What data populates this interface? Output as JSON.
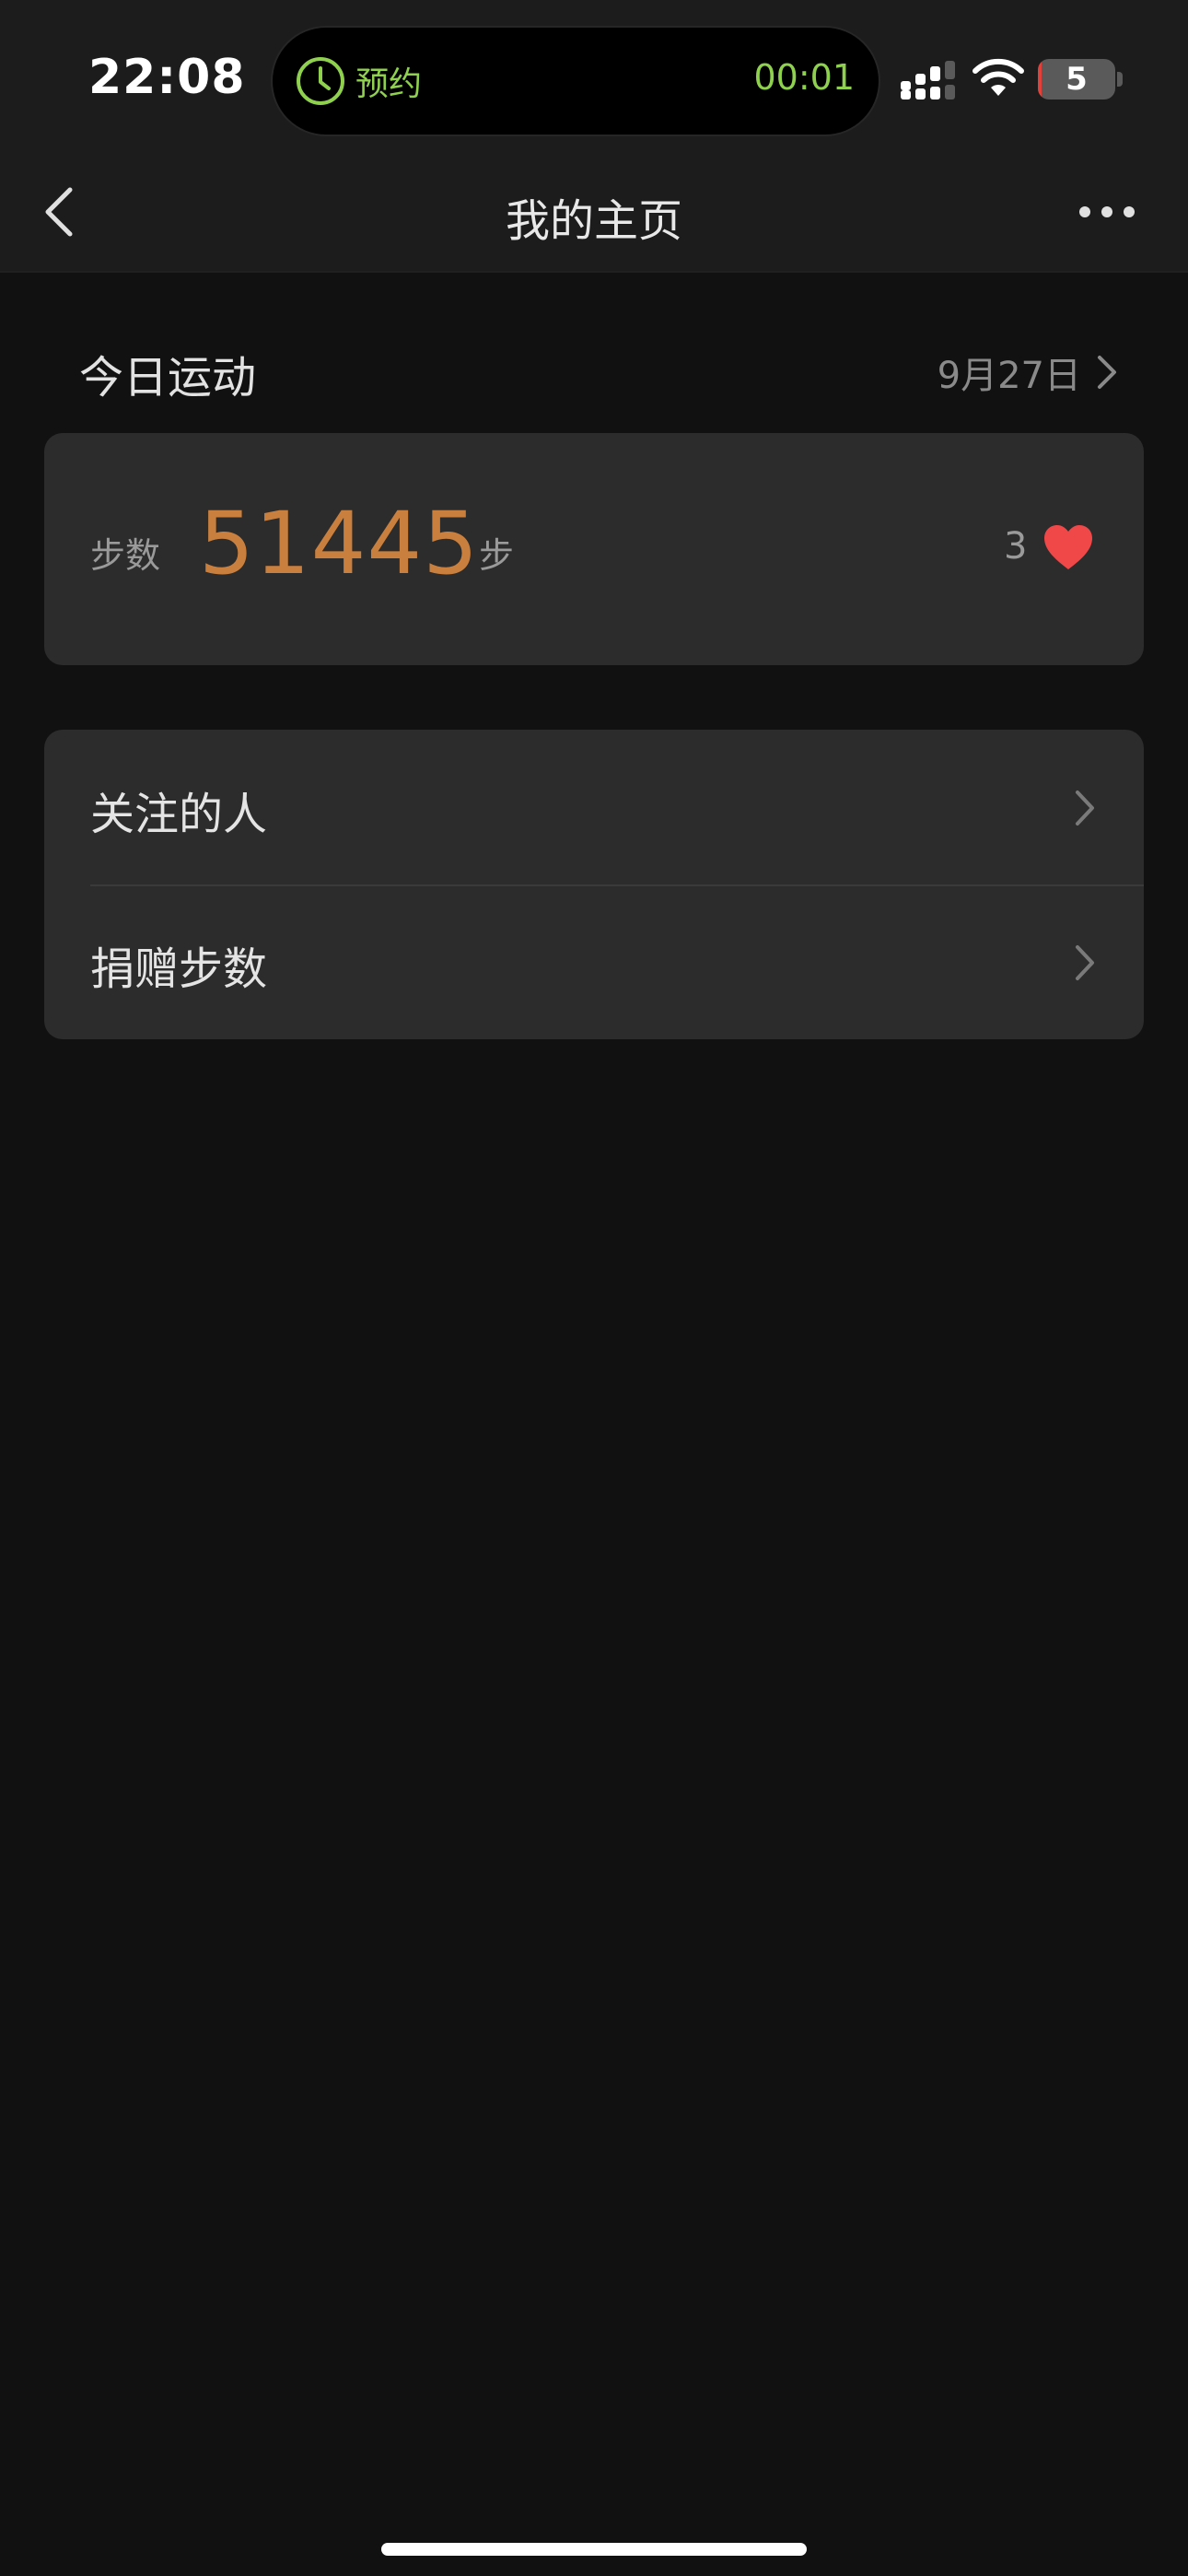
{
  "status_bar": {
    "time": "22:08",
    "island_label": "预约",
    "island_timer": "00:01",
    "battery_level": "5",
    "battery_fraction": 0.05,
    "accent_color": "#8fd14f",
    "icons": [
      "clock-icon",
      "signal-icon",
      "wifi-icon",
      "battery-icon"
    ]
  },
  "nav": {
    "title": "我的主页",
    "back_icon": "chevron-left-icon",
    "more_icon": "more-dots-icon"
  },
  "today": {
    "title": "今日运动",
    "date": "9月27日",
    "steps_label": "步数",
    "steps_value": "51445",
    "steps_unit": "步",
    "likes": "3",
    "steps_color": "#c9803f",
    "heart_color": "#f04848"
  },
  "menu": {
    "items": [
      {
        "label": "关注的人"
      },
      {
        "label": "捐赠步数"
      }
    ]
  }
}
